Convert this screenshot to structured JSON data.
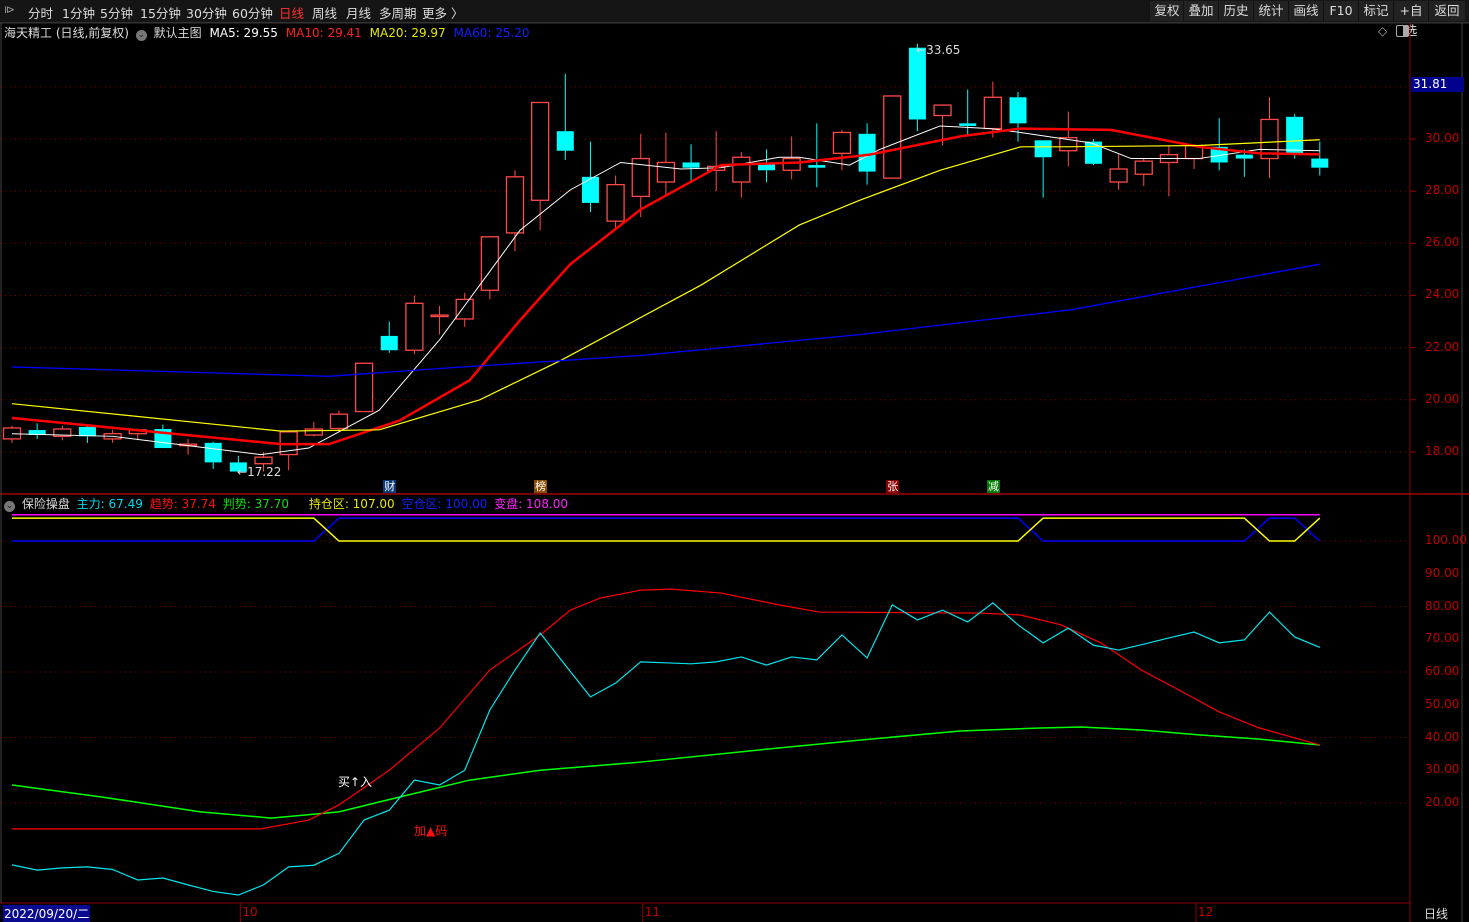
{
  "toolbar": {
    "tabs": [
      "分时",
      "1分钟",
      "5分钟",
      "15分钟",
      "30分钟",
      "60分钟",
      "日线",
      "周线",
      "月线",
      "多周期",
      "更多 〉"
    ],
    "active_tab": "日线",
    "right_buttons": [
      "复权",
      "叠加",
      "历史",
      "统计",
      "画线",
      "F10",
      "标记",
      "+自选",
      "返回"
    ]
  },
  "main_legend": {
    "title": "海天精工 (日线,前复权)",
    "template": "默认主图",
    "ma5": "MA5: 29.55",
    "ma10": "MA10: 29.41",
    "ma20": "MA20: 29.97",
    "ma60": "MA60: 25.20"
  },
  "sub_legend": {
    "name": "保险操盘",
    "zhuli": "主力: 67.49",
    "qushi": "趋势: 37.74",
    "panshi": "判势: 37.70",
    "chicang": "持仓区: 107.00",
    "kongcang": "空仓区: 100.00",
    "biancheng": "变盘: 108.00"
  },
  "colors": {
    "up": "#ff4848",
    "down": "#00ffff",
    "ma5": "#ffffff",
    "ma10": "#ff0000",
    "ma20": "#ffff00",
    "ma60": "#0000ff",
    "zhuli": "#00e5ee",
    "qushi": "#ff0000",
    "panshi": "#00ff00",
    "chicang": "#ffff00",
    "kongcang": "#0000ff",
    "biancheng": "#ff00ff",
    "axis": "#c00000"
  },
  "annotations": {
    "high": "33.65",
    "low": "17.22",
    "buy": "买↑入",
    "add": "加▲码",
    "current_price": "31.81",
    "events": [
      {
        "label": "财",
        "index": 15,
        "color": "#0b3a78"
      },
      {
        "label": "榜",
        "index": 21,
        "color": "#8a4a00"
      },
      {
        "label": "张",
        "index": 35,
        "color": "#8a0000"
      },
      {
        "label": "减",
        "index": 39,
        "color": "#007a00"
      }
    ]
  },
  "x_axis": {
    "date_label": "2022/09/20/二",
    "months": [
      {
        "label": "10",
        "index": 9
      },
      {
        "label": "11",
        "index": 25
      },
      {
        "label": "12",
        "index": 47
      }
    ],
    "period": "日线"
  },
  "chart_data": [
    {
      "type": "candlestick",
      "title": "海天精工 (日线,前复权)",
      "y_ticks": [
        "18.00",
        "20.00",
        "22.00",
        "24.00",
        "26.00",
        "28.00",
        "30.00"
      ],
      "ylim": [
        16.5,
        33.8
      ],
      "ohlc": [
        [
          18.5,
          18.92,
          19.0,
          18.35
        ],
        [
          18.84,
          18.65,
          19.1,
          18.5
        ],
        [
          18.6,
          18.88,
          19.0,
          18.45
        ],
        [
          18.96,
          18.6,
          19.05,
          18.35
        ],
        [
          18.5,
          18.7,
          18.85,
          18.35
        ],
        [
          18.7,
          18.85,
          18.9,
          18.45
        ],
        [
          18.88,
          18.15,
          19.05,
          18.15
        ],
        [
          18.25,
          18.3,
          18.5,
          17.9
        ],
        [
          18.35,
          17.6,
          18.4,
          17.35
        ],
        [
          17.6,
          17.25,
          17.85,
          17.22
        ],
        [
          17.55,
          17.8,
          18.0,
          17.25
        ],
        [
          17.9,
          18.77,
          18.8,
          17.3
        ],
        [
          18.65,
          18.88,
          19.15,
          18.6
        ],
        [
          18.9,
          19.45,
          19.6,
          18.75
        ],
        [
          19.55,
          21.4,
          21.4,
          19.55
        ],
        [
          22.45,
          21.9,
          23.0,
          21.8
        ],
        [
          21.9,
          23.7,
          24.0,
          21.75
        ],
        [
          23.2,
          23.25,
          23.6,
          22.5
        ],
        [
          23.1,
          23.85,
          24.1,
          22.8
        ],
        [
          24.2,
          26.25,
          26.25,
          23.85
        ],
        [
          26.4,
          28.55,
          28.8,
          25.7
        ],
        [
          27.65,
          31.4,
          31.4,
          26.5
        ],
        [
          30.3,
          29.55,
          32.5,
          29.2
        ],
        [
          28.55,
          27.55,
          29.9,
          27.2
        ],
        [
          26.85,
          28.25,
          28.6,
          26.5
        ],
        [
          27.8,
          29.25,
          30.2,
          27.0
        ],
        [
          28.35,
          29.1,
          30.25,
          27.85
        ],
        [
          29.1,
          28.9,
          29.8,
          28.4
        ],
        [
          28.8,
          28.95,
          30.3,
          28.0
        ],
        [
          28.35,
          29.3,
          29.5,
          27.75
        ],
        [
          29.05,
          28.8,
          29.6,
          28.35
        ],
        [
          28.8,
          29.25,
          30.1,
          28.45
        ],
        [
          29.0,
          28.9,
          30.6,
          28.15
        ],
        [
          29.45,
          30.25,
          30.35,
          28.8
        ],
        [
          30.2,
          28.75,
          30.6,
          28.25
        ],
        [
          28.5,
          31.65,
          31.65,
          28.5
        ],
        [
          33.5,
          30.75,
          33.65,
          30.3
        ],
        [
          30.9,
          31.3,
          31.3,
          29.75
        ],
        [
          30.6,
          30.5,
          31.9,
          30.1
        ],
        [
          30.4,
          31.6,
          32.2,
          30.05
        ],
        [
          31.6,
          30.6,
          31.8,
          29.9
        ],
        [
          29.95,
          29.3,
          29.95,
          27.75
        ],
        [
          29.55,
          30.05,
          31.05,
          28.95
        ],
        [
          29.9,
          29.05,
          30.0,
          29.0
        ],
        [
          28.35,
          28.85,
          29.45,
          28.05
        ],
        [
          28.65,
          29.15,
          29.25,
          28.2
        ],
        [
          29.1,
          29.4,
          29.75,
          27.8
        ],
        [
          29.25,
          29.75,
          29.8,
          28.85
        ],
        [
          29.7,
          29.1,
          30.8,
          28.8
        ],
        [
          29.4,
          29.25,
          29.6,
          28.55
        ],
        [
          29.25,
          30.75,
          31.6,
          28.5
        ],
        [
          30.85,
          29.45,
          30.95,
          29.25
        ],
        [
          29.25,
          28.9,
          29.9,
          28.6
        ]
      ],
      "ma_series": [
        {
          "name": "MA5",
          "points": [
            [
              0,
              18.7
            ],
            [
              4,
              18.6
            ],
            [
              9.9,
              17.9
            ],
            [
              11.8,
              18.15
            ],
            [
              14.6,
              19.6
            ],
            [
              17,
              22.3
            ],
            [
              20.2,
              26.5
            ],
            [
              22.2,
              28.05
            ],
            [
              24.2,
              29.1
            ],
            [
              26.6,
              28.85
            ],
            [
              28.2,
              28.9
            ],
            [
              30.5,
              29.3
            ],
            [
              31.3,
              29.3
            ],
            [
              33.3,
              29.0
            ],
            [
              34.5,
              29.6
            ],
            [
              36.9,
              30.5
            ],
            [
              38.9,
              30.4
            ],
            [
              40.1,
              30.25
            ],
            [
              42.9,
              29.85
            ],
            [
              44.5,
              29.25
            ],
            [
              47.2,
              29.25
            ],
            [
              49.6,
              29.6
            ],
            [
              52,
              29.55
            ]
          ]
        },
        {
          "name": "MA10",
          "points": [
            [
              0,
              19.3
            ],
            [
              10.7,
              18.3
            ],
            [
              12.6,
              18.3
            ],
            [
              15.4,
              19.2
            ],
            [
              18.2,
              20.75
            ],
            [
              20.2,
              23.05
            ],
            [
              22.2,
              25.2
            ],
            [
              25,
              27.3
            ],
            [
              28.2,
              29.0
            ],
            [
              31.3,
              29.1
            ],
            [
              34.1,
              29.4
            ],
            [
              37.7,
              30.1
            ],
            [
              40.1,
              30.4
            ],
            [
              43.7,
              30.35
            ],
            [
              47.2,
              29.7
            ],
            [
              49.6,
              29.45
            ],
            [
              52,
              29.41
            ]
          ]
        },
        {
          "name": "MA20",
          "points": [
            [
              0,
              19.85
            ],
            [
              10.7,
              18.8
            ],
            [
              14.6,
              18.85
            ],
            [
              18.6,
              20.0
            ],
            [
              21.8,
              21.5
            ],
            [
              27.4,
              24.4
            ],
            [
              31.3,
              26.7
            ],
            [
              33.7,
              27.65
            ],
            [
              36.9,
              28.8
            ],
            [
              40.1,
              29.7
            ],
            [
              41.7,
              29.7
            ],
            [
              47.2,
              29.75
            ],
            [
              52,
              29.97
            ]
          ]
        },
        {
          "name": "MA60",
          "points": [
            [
              0,
              21.26
            ],
            [
              12.6,
              20.9
            ],
            [
              17,
              21.2
            ],
            [
              25,
              21.7
            ],
            [
              33.7,
              22.5
            ],
            [
              42.1,
              23.45
            ],
            [
              52,
              25.2
            ]
          ]
        }
      ]
    },
    {
      "type": "line",
      "title": "保险操盘",
      "y_ticks": [
        "100.00",
        "90.00",
        "80.00",
        "70.00",
        "60.00",
        "50.00",
        "40.00",
        "30.00",
        "20.00"
      ],
      "ylim": [
        -10,
        110
      ],
      "series": [
        {
          "name": "主力",
          "values": [
            1.1,
            -0.5,
            0.2,
            0.5,
            -0.3,
            -3.5,
            -2.9,
            -5,
            -7,
            -8.1,
            -5,
            0.5,
            1,
            4.6,
            14.8,
            17.8,
            27,
            25.5,
            30,
            48.4,
            60.6,
            71.9,
            62.1,
            52.4,
            56.6,
            63.1,
            62.8,
            62.5,
            63.1,
            64.6,
            62.1,
            64.6,
            63.7,
            71.3,
            64.3,
            80.5,
            75.9,
            78.9,
            75.3,
            81.1,
            74.4,
            68.9,
            73.4,
            68.2,
            66.7,
            68.5,
            70.4,
            72.2,
            68.9,
            69.8,
            78.3,
            70.7,
            67.49
          ]
        },
        {
          "name": "趋势",
          "points": [
            [
              0,
              12.1
            ],
            [
              9.9,
              12.1
            ],
            [
              11.8,
              14.8
            ],
            [
              13,
              19.4
            ],
            [
              15,
              30
            ],
            [
              17,
              42.9
            ],
            [
              19,
              60.6
            ],
            [
              21,
              71.3
            ],
            [
              22.2,
              78.9
            ],
            [
              23.4,
              82.6
            ],
            [
              25,
              85
            ],
            [
              26.2,
              85.3
            ],
            [
              28.2,
              84.1
            ],
            [
              30.5,
              80.5
            ],
            [
              32.1,
              78.3
            ],
            [
              38.5,
              78
            ],
            [
              40.1,
              77.4
            ],
            [
              41.7,
              74.4
            ],
            [
              43.3,
              68.9
            ],
            [
              44.9,
              60.6
            ],
            [
              46.4,
              54.5
            ],
            [
              48,
              47.8
            ],
            [
              49.6,
              42.9
            ],
            [
              52,
              37.74
            ]
          ]
        },
        {
          "name": "判势",
          "points": [
            [
              0,
              25.5
            ],
            [
              3.6,
              21.8
            ],
            [
              7.5,
              17.3
            ],
            [
              10.3,
              15.4
            ],
            [
              13,
              17.3
            ],
            [
              15.4,
              21.8
            ],
            [
              18.2,
              27
            ],
            [
              21,
              30
            ],
            [
              25,
              32.5
            ],
            [
              29.7,
              36.2
            ],
            [
              33.7,
              39.2
            ],
            [
              37.7,
              42
            ],
            [
              40.9,
              42.9
            ],
            [
              42.5,
              43.2
            ],
            [
              44.9,
              42.3
            ],
            [
              47.2,
              40.8
            ],
            [
              49.6,
              39.5
            ],
            [
              52,
              37.7
            ]
          ]
        },
        {
          "name": "持仓区",
          "states": [
            107,
            107,
            107,
            107,
            107,
            107,
            107,
            107,
            107,
            107,
            107,
            107,
            107,
            100,
            100,
            100,
            100,
            100,
            100,
            100,
            100,
            100,
            100,
            100,
            100,
            100,
            100,
            100,
            100,
            100,
            100,
            100,
            100,
            100,
            100,
            100,
            100,
            100,
            100,
            100,
            100,
            107,
            107,
            107,
            107,
            107,
            107,
            107,
            107,
            107,
            100,
            100,
            107
          ]
        },
        {
          "name": "空仓区",
          "states": [
            100,
            100,
            100,
            100,
            100,
            100,
            100,
            100,
            100,
            100,
            100,
            100,
            100,
            107,
            107,
            107,
            107,
            107,
            107,
            107,
            107,
            107,
            107,
            107,
            107,
            107,
            107,
            107,
            107,
            107,
            107,
            107,
            107,
            107,
            107,
            107,
            107,
            107,
            107,
            107,
            107,
            100,
            100,
            100,
            100,
            100,
            100,
            100,
            100,
            100,
            107,
            107,
            100
          ]
        },
        {
          "name": "变盘",
          "value": 108
        }
      ],
      "signals": [
        {
          "label": "买↑入",
          "index": 13.2
        },
        {
          "label": "加▲码",
          "index": 16.3
        }
      ]
    }
  ]
}
